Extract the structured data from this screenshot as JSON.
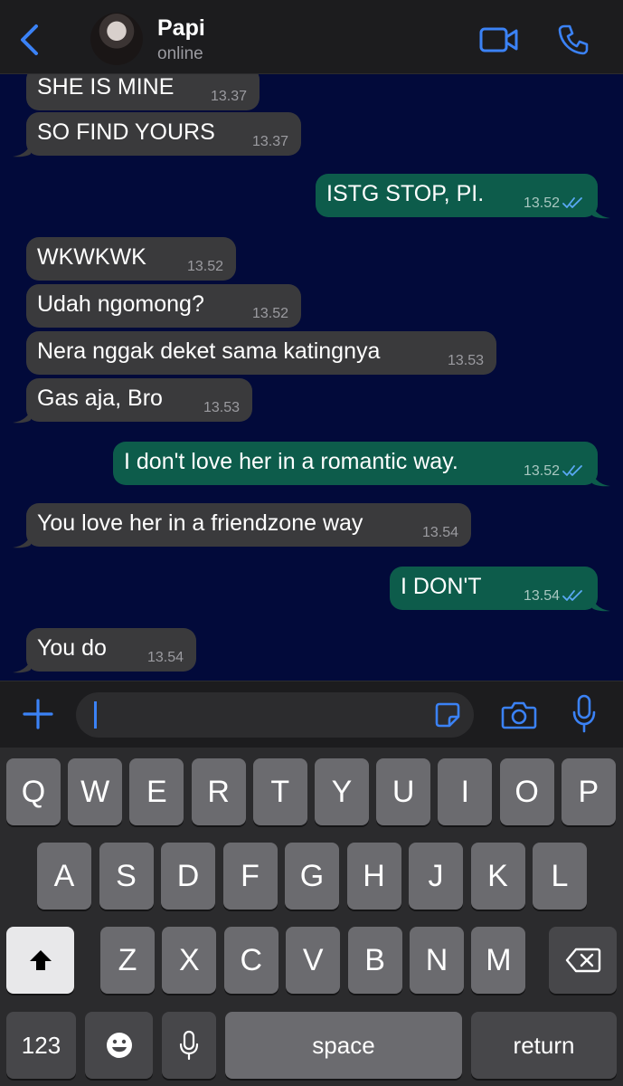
{
  "header": {
    "contact_name": "Papi",
    "status": "online",
    "back_icon": "chevron-left-icon",
    "video_icon": "video-camera-icon",
    "call_icon": "phone-icon",
    "accent_color": "#3b82f6"
  },
  "messages": [
    {
      "dir": "in",
      "text": "SHE IS MINE",
      "time": "13.37"
    },
    {
      "dir": "in",
      "text": "SO FIND YOURS",
      "time": "13.37"
    },
    {
      "dir": "out",
      "text": "ISTG STOP, PI.",
      "time": "13.52",
      "read": true
    },
    {
      "dir": "in",
      "text": "WKWKWK",
      "time": "13.52"
    },
    {
      "dir": "in",
      "text": "Udah ngomong?",
      "time": "13.52"
    },
    {
      "dir": "in",
      "text": "Nera nggak deket sama katingnya",
      "time": "13.53"
    },
    {
      "dir": "in",
      "text": "Gas aja, Bro",
      "time": "13.53"
    },
    {
      "dir": "out",
      "text": "I don't love her in a romantic way.",
      "time": "13.52",
      "read": true
    },
    {
      "dir": "in",
      "text": "You love her in a friendzone way",
      "time": "13.54"
    },
    {
      "dir": "out",
      "text": "I DON'T",
      "time": "13.54",
      "read": true
    },
    {
      "dir": "in",
      "text": "You do",
      "time": "13.54"
    }
  ],
  "input": {
    "value": "",
    "plus_icon": "plus-icon",
    "sticker_icon": "sticker-icon",
    "camera_icon": "camera-icon",
    "mic_icon": "microphone-icon"
  },
  "keyboard": {
    "row1": [
      "Q",
      "W",
      "E",
      "R",
      "T",
      "Y",
      "U",
      "I",
      "O",
      "P"
    ],
    "row2": [
      "A",
      "S",
      "D",
      "F",
      "G",
      "H",
      "J",
      "K",
      "L"
    ],
    "row3": [
      "Z",
      "X",
      "C",
      "V",
      "B",
      "N",
      "M"
    ],
    "numbers_label": "123",
    "space_label": "space",
    "return_label": "return",
    "shift_icon": "shift-icon",
    "delete_icon": "backspace-icon",
    "emoji_icon": "emoji-icon",
    "dictation_icon": "microphone-icon"
  }
}
